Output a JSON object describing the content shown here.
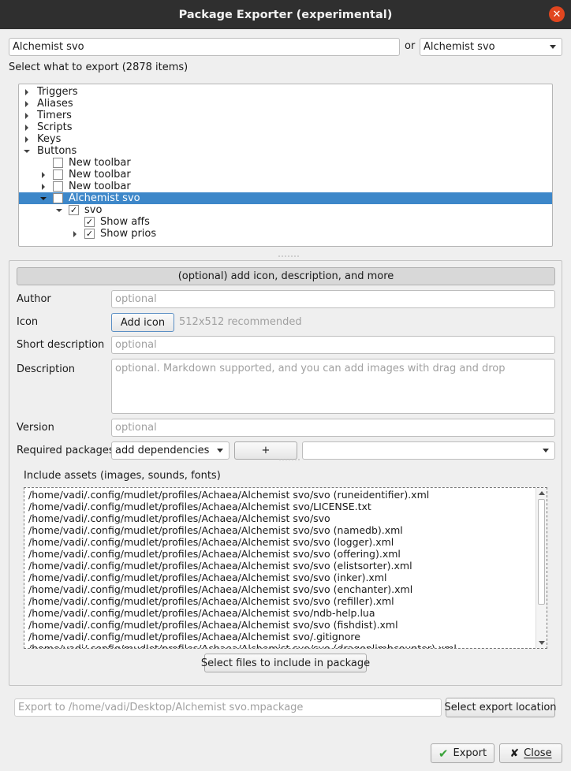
{
  "window": {
    "title": "Package Exporter (experimental)"
  },
  "package": {
    "name_value": "Alchemist svo",
    "or_label": "or",
    "select_value": "Alchemist svo"
  },
  "export_header": "Select what to export (2878 items)",
  "tree": [
    {
      "label": "Triggers",
      "expander": "collapsed",
      "checkbox": null,
      "selected": false
    },
    {
      "label": "Aliases",
      "expander": "collapsed",
      "checkbox": null,
      "selected": false
    },
    {
      "label": "Timers",
      "expander": "collapsed",
      "checkbox": null,
      "selected": false
    },
    {
      "label": "Scripts",
      "expander": "collapsed",
      "checkbox": null,
      "selected": false
    },
    {
      "label": "Keys",
      "expander": "collapsed",
      "checkbox": null,
      "selected": false
    },
    {
      "label": "Buttons",
      "expander": "expanded",
      "checkbox": null,
      "selected": false
    },
    {
      "label": "New toolbar",
      "expander": "none",
      "checkbox": "unchecked",
      "selected": false
    },
    {
      "label": "New toolbar",
      "expander": "collapsed",
      "checkbox": "unchecked",
      "selected": false
    },
    {
      "label": "New toolbar",
      "expander": "collapsed",
      "checkbox": "unchecked",
      "selected": false
    },
    {
      "label": "Alchemist svo",
      "expander": "expanded",
      "checkbox": "unchecked",
      "selected": true
    },
    {
      "label": "svo",
      "expander": "expanded",
      "checkbox": "checked",
      "selected": false
    },
    {
      "label": "Show affs",
      "expander": "none",
      "checkbox": "checked",
      "selected": false
    },
    {
      "label": "Show prios",
      "expander": "collapsed",
      "checkbox": "checked",
      "selected": false
    }
  ],
  "details": {
    "toggle_label": "(optional) add icon, description, and more",
    "author_label": "Author",
    "author_placeholder": "optional",
    "icon_label": "Icon",
    "add_icon_button": "Add icon",
    "icon_hint": "512x512 recommended",
    "short_desc_label": "Short description",
    "short_desc_placeholder": "optional",
    "description_label": "Description",
    "description_placeholder": "optional. Markdown supported, and you can add images with drag and drop",
    "version_label": "Version",
    "version_placeholder": "optional",
    "required_label": "Required packages",
    "dependencies_value": "add dependencies",
    "plus_button": "+",
    "dependency_select_value": ""
  },
  "assets": {
    "label": "Include assets (images, sounds, fonts)",
    "files": [
      "/home/vadi/.config/mudlet/profiles/Achaea/Alchemist svo/svo (runeidentifier).xml",
      "/home/vadi/.config/mudlet/profiles/Achaea/Alchemist svo/LICENSE.txt",
      "/home/vadi/.config/mudlet/profiles/Achaea/Alchemist svo/svo",
      "/home/vadi/.config/mudlet/profiles/Achaea/Alchemist svo/svo (namedb).xml",
      "/home/vadi/.config/mudlet/profiles/Achaea/Alchemist svo/svo (logger).xml",
      "/home/vadi/.config/mudlet/profiles/Achaea/Alchemist svo/svo (offering).xml",
      "/home/vadi/.config/mudlet/profiles/Achaea/Alchemist svo/svo (elistsorter).xml",
      "/home/vadi/.config/mudlet/profiles/Achaea/Alchemist svo/svo (inker).xml",
      "/home/vadi/.config/mudlet/profiles/Achaea/Alchemist svo/svo (enchanter).xml",
      "/home/vadi/.config/mudlet/profiles/Achaea/Alchemist svo/svo (refiller).xml",
      "/home/vadi/.config/mudlet/profiles/Achaea/Alchemist svo/ndb-help.lua",
      "/home/vadi/.config/mudlet/profiles/Achaea/Alchemist svo/svo (fishdist).xml",
      "/home/vadi/.config/mudlet/profiles/Achaea/Alchemist svo/.gitignore",
      "/home/vadi/.config/mudlet/profiles/Achaea/Alchemist svo/svo (dragonlimbcounter).xml"
    ],
    "select_files_button": "Select files to include in package"
  },
  "export": {
    "location_placeholder": "Export to /home/vadi/Desktop/Alchemist svo.mpackage",
    "select_location_button": "Select export location",
    "export_button": "Export",
    "close_button": "Close"
  },
  "colors": {
    "titlebar": "#2f2f2f",
    "selection": "#3d87c9",
    "close_accent": "#e1461f",
    "export_check": "#3aa33a"
  }
}
